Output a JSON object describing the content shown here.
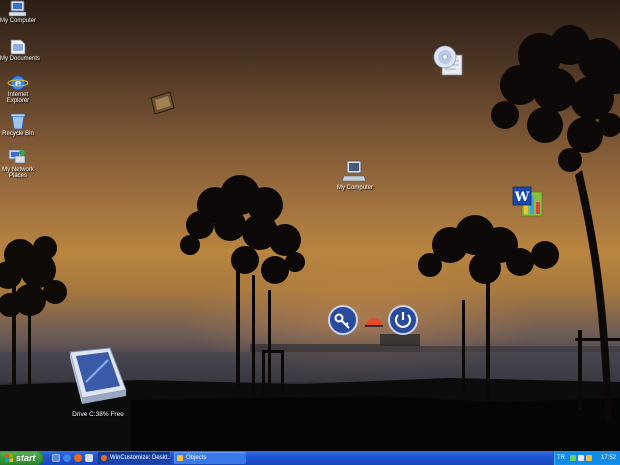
{
  "desktop": {
    "icons": [
      {
        "label": "My Computer"
      },
      {
        "label": "My Documents"
      },
      {
        "label": "Internet Explorer"
      },
      {
        "label": "Recycle Bin"
      },
      {
        "label": "My Network Places"
      }
    ],
    "center_icon_label": "My Computer",
    "drive_widget_label": "Drive C:38% Free"
  },
  "taskbar": {
    "start_label": "start",
    "tasks": [
      {
        "label": "WinCustomize: Deskt...",
        "active": true
      },
      {
        "label": "Objects",
        "active": false
      }
    ],
    "tray": {
      "language": "TR",
      "clock": "17:52"
    }
  },
  "colors": {
    "taskbar_blue": "#245edb",
    "start_green": "#3a9a3a",
    "tray_blue": "#0f8be8",
    "sunset_orange": "#b9853f"
  }
}
